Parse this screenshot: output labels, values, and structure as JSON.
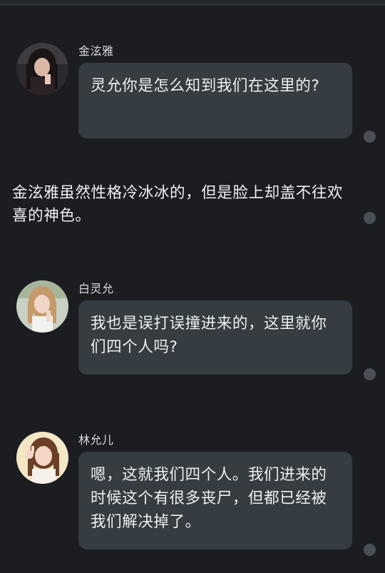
{
  "messages": [
    {
      "sender": "金泫雅",
      "text": "灵允你是怎么知到我们在这里的?",
      "avatar": "avatar-jin-xuanya"
    },
    {
      "narration": "金泫雅虽然性格冷冰冰的，但是脸上却盖不往欢喜的神色。"
    },
    {
      "sender": "白灵允",
      "text": "我也是误打误撞进来的，这里就你们四个人吗?",
      "avatar": "avatar-bai-lingyun"
    },
    {
      "sender": "林允儿",
      "text": "嗯，这就我们四个人。我们进来的时候这个有很多丧尸，但都已经被我们解决掉了。",
      "avatar": "avatar-lin-yuner"
    }
  ],
  "colors": {
    "background": "#1b1d21",
    "bubble": "#353c42",
    "text": "#eef0f2",
    "dot": "#4a4f55"
  }
}
